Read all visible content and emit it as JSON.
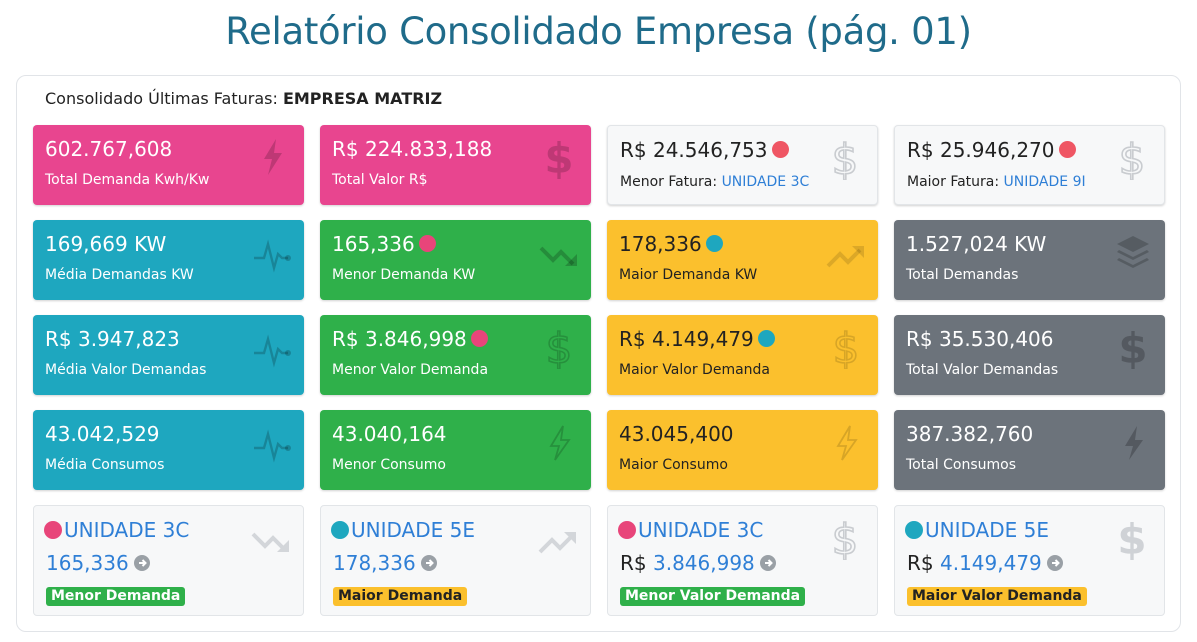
{
  "page": {
    "title": "Relatório Consolidado Empresa (pág. 01)"
  },
  "panel": {
    "header_prefix": "Consolidado Últimas Faturas:",
    "header_company": "EMPRESA MATRIZ"
  },
  "colors": {
    "pink": "#e8458f",
    "cyan": "#1ea7bf",
    "green": "#2fb04a",
    "yellow": "#fbc02d",
    "grey": "#6c737b",
    "link": "#2f7fd6",
    "title": "#1f6b8a"
  },
  "row1": [
    {
      "value": "602.767,608",
      "label": "Total Demanda Kwh/Kw",
      "icon": "bolt-icon"
    },
    {
      "value": "R$ 224.833,188",
      "label": "Total Valor R$",
      "icon": "dollar-icon"
    },
    {
      "value": "R$ 24.546,753",
      "label": "Menor Fatura:",
      "unit": "UNIDADE 3C",
      "icon": "dollar-outline-icon"
    },
    {
      "value": "R$ 25.946,270",
      "label": "Maior Fatura:",
      "unit": "UNIDADE 9I",
      "icon": "dollar-outline-icon"
    }
  ],
  "row2": [
    {
      "value": "169,669 KW",
      "label": "Média Demandas KW",
      "icon": "pulse-icon"
    },
    {
      "value": "165,336",
      "label": "Menor Demanda KW",
      "icon": "trend-down-icon"
    },
    {
      "value": "178,336",
      "label": "Maior Demanda KW",
      "icon": "trend-up-icon"
    },
    {
      "value": "1.527,024 KW",
      "label": "Total Demandas",
      "icon": "layers-icon"
    }
  ],
  "row3": [
    {
      "value": "R$ 3.947,823",
      "label": "Média Valor Demandas",
      "icon": "pulse-icon"
    },
    {
      "value": "R$ 3.846,998",
      "label": "Menor Valor Demanda",
      "icon": "dollar-outline-icon"
    },
    {
      "value": "R$ 4.149,479",
      "label": "Maior Valor Demanda",
      "icon": "dollar-outline-icon"
    },
    {
      "value": "R$ 35.530,406",
      "label": "Total Valor Demandas",
      "icon": "dollar-icon"
    }
  ],
  "row4": [
    {
      "value": "43.042,529",
      "label": "Média Consumos",
      "icon": "pulse-icon"
    },
    {
      "value": "43.040,164",
      "label": "Menor Consumo",
      "icon": "bolt-outline-icon"
    },
    {
      "value": "43.045,400",
      "label": "Maior Consumo",
      "icon": "bolt-outline-icon"
    },
    {
      "value": "387.382,760",
      "label": "Total Consumos",
      "icon": "bolt-icon"
    }
  ],
  "row5": [
    {
      "unit": "UNIDADE 3C",
      "value": "165,336",
      "prefix": "",
      "badge": "Menor Demanda",
      "icon": "trend-down-icon"
    },
    {
      "unit": "UNIDADE 5E",
      "value": "178,336",
      "prefix": "",
      "badge": "Maior Demanda",
      "icon": "trend-up-icon"
    },
    {
      "unit": "UNIDADE 3C",
      "value": "3.846,998",
      "prefix": "R$",
      "badge": "Menor Valor Demanda",
      "icon": "dollar-outline-icon"
    },
    {
      "unit": "UNIDADE 5E",
      "value": "4.149,479",
      "prefix": "R$",
      "badge": "Maior Valor Demanda",
      "icon": "dollar-icon"
    }
  ]
}
